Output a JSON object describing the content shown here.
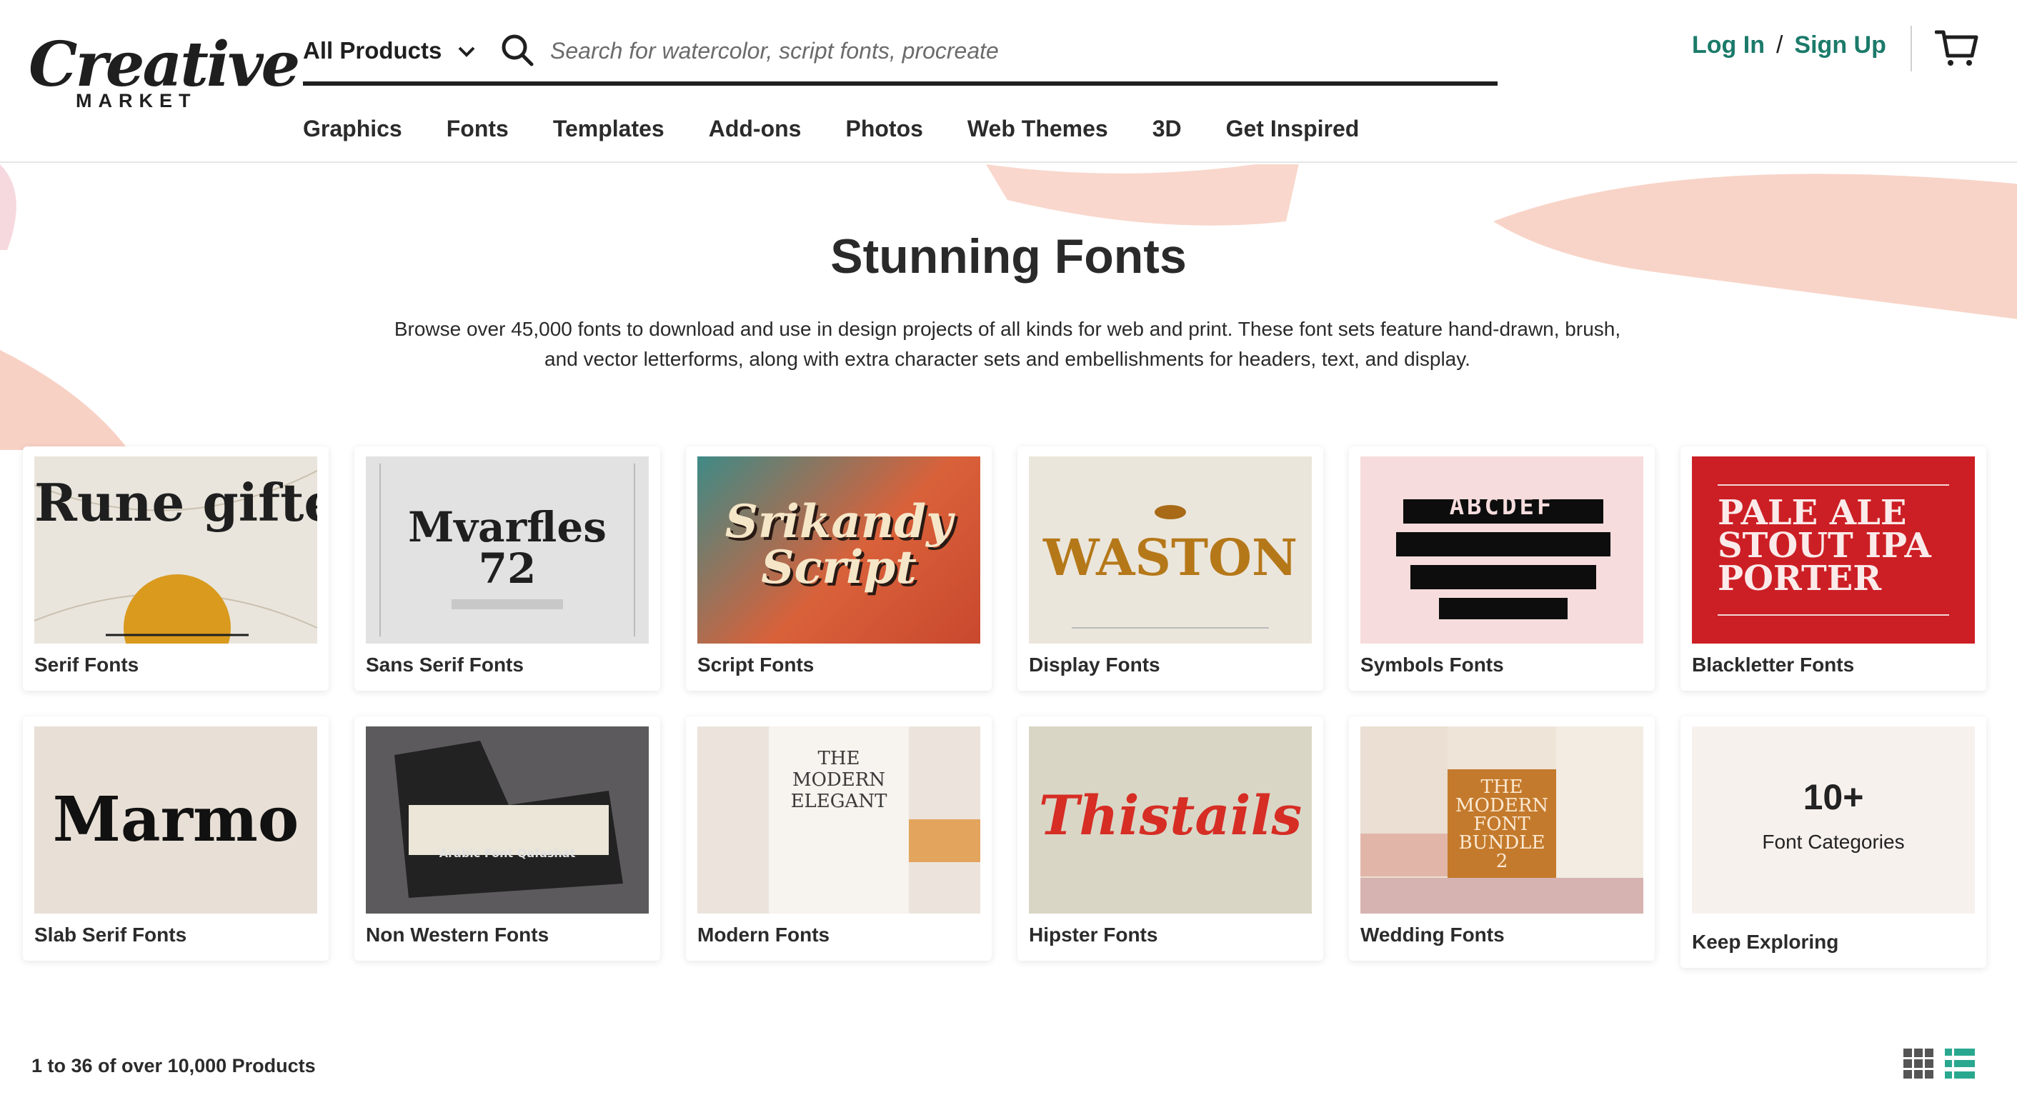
{
  "header": {
    "logo": {
      "word": "Creative",
      "sub": "MARKET"
    },
    "search": {
      "category_label": "All Products",
      "placeholder": "Search for watercolor, script fonts, procreate"
    },
    "auth": {
      "login": "Log In",
      "separator": "/",
      "signup": "Sign Up"
    },
    "nav": [
      "Graphics",
      "Fonts",
      "Templates",
      "Add-ons",
      "Photos",
      "Web Themes",
      "3D",
      "Get Inspired"
    ]
  },
  "hero": {
    "title": "Stunning Fonts",
    "description": "Browse over 45,000 fonts to download and use in design projects of all kinds for web and print. These font sets feature hand-drawn, brush, and vector letterforms, along with extra character sets and embellishments for headers, text, and display."
  },
  "categories": [
    {
      "label": "Serif Fonts",
      "thumb_text": "Rune gifter",
      "thumb_bg": "#e9e5dc"
    },
    {
      "label": "Sans Serif Fonts",
      "thumb_text": "Mvarfles 72",
      "thumb_bg": "#e2e2e2"
    },
    {
      "label": "Script Fonts",
      "thumb_text": "Srikandy Script",
      "thumb_bg": "#d9613a"
    },
    {
      "label": "Display Fonts",
      "thumb_text": "WASTON",
      "thumb_bg": "#ebe6dc"
    },
    {
      "label": "Symbols Fonts",
      "thumb_text": "ABCDEF",
      "thumb_bg": "#f6dcdc"
    },
    {
      "label": "Blackletter Fonts",
      "thumb_text": "PALE ALE STOUT IPA PORTER",
      "thumb_bg": "#cc1f25"
    },
    {
      "label": "Slab Serif Fonts",
      "thumb_text": "Marmo",
      "thumb_bg": "#e8e0d6"
    },
    {
      "label": "Non Western Fonts",
      "thumb_text": "Arabic Font Qafashat",
      "thumb_bg": "#5c5a5d"
    },
    {
      "label": "Modern Fonts",
      "thumb_text": "THE MODERN ELEGANT",
      "thumb_bg": "#f1ebe4"
    },
    {
      "label": "Hipster Fonts",
      "thumb_text": "Thistails",
      "thumb_bg": "#d9d6c6"
    },
    {
      "label": "Wedding Fonts",
      "thumb_text": "THE MODERN FONT BUNDLE 2",
      "thumb_bg": "#c47a2c"
    },
    {
      "label": "Keep Exploring",
      "thumb_text": "10+",
      "thumb_sub": "Font Categories",
      "thumb_bg": "#f7f1ed"
    }
  ],
  "results": {
    "count_text": "1 to 36 of over 10,000 Products"
  },
  "colors": {
    "brand_green": "#1b7a6a",
    "text_dark": "#1f1f1f",
    "brush_pink": "#f3b6a3"
  },
  "icons": [
    "chevron-down-icon",
    "search-icon",
    "cart-icon",
    "grid-view-icon",
    "list-view-icon"
  ]
}
